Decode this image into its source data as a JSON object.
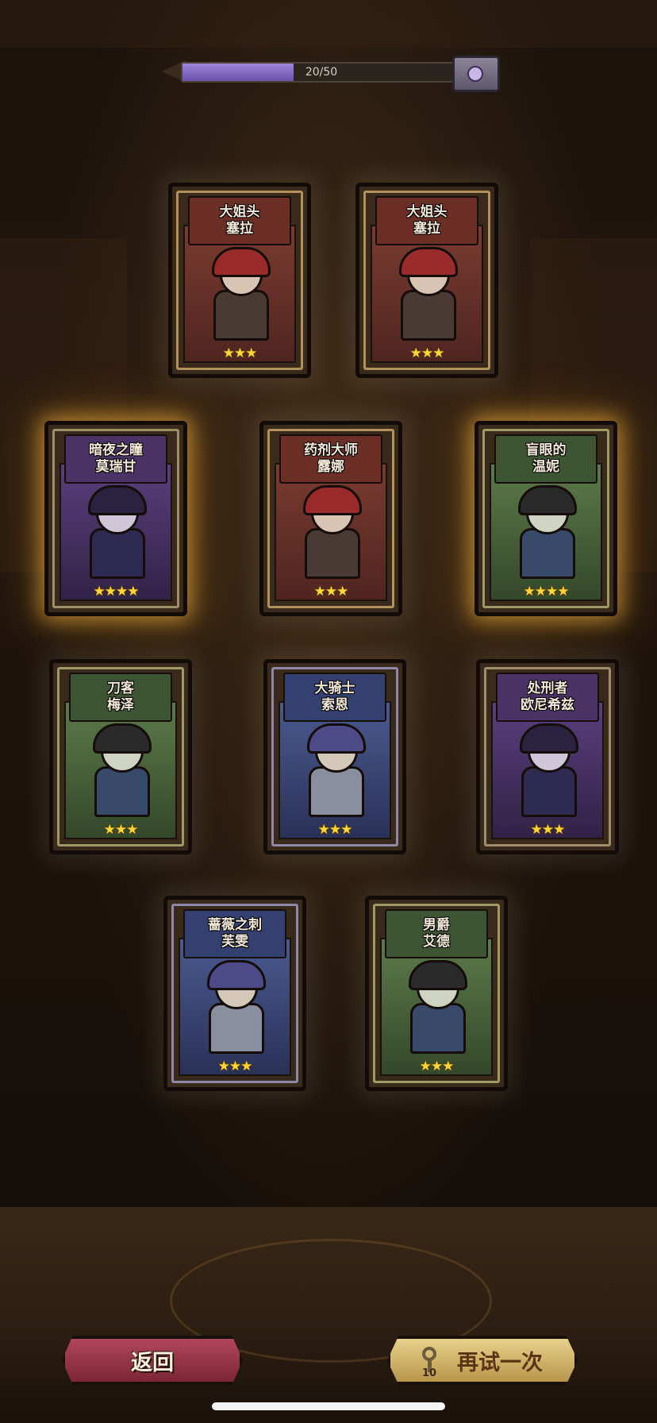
{
  "progress": {
    "text": "20/50",
    "fraction": 0.4
  },
  "cards": [
    {
      "title": "大姐头",
      "name": "塞拉",
      "stars": 3,
      "theme": "red",
      "glow": false
    },
    {
      "title": "大姐头",
      "name": "塞拉",
      "stars": 3,
      "theme": "red",
      "glow": false
    },
    {
      "title": "暗夜之瞳",
      "name": "莫瑞甘",
      "stars": 4,
      "theme": "purple",
      "glow": true
    },
    {
      "title": "药剂大师",
      "name": "露娜",
      "stars": 3,
      "theme": "red",
      "glow": false
    },
    {
      "title": "盲眼的",
      "name": "温妮",
      "stars": 4,
      "theme": "green",
      "glow": true
    },
    {
      "title": "刀客",
      "name": "梅泽",
      "stars": 3,
      "theme": "green",
      "glow": false
    },
    {
      "title": "大骑士",
      "name": "索恩",
      "stars": 3,
      "theme": "blue",
      "glow": false
    },
    {
      "title": "处刑者",
      "name": "欧尼希兹",
      "stars": 3,
      "theme": "purple",
      "glow": false
    },
    {
      "title": "蔷薇之刺",
      "name": "芙雯",
      "stars": 3,
      "theme": "blue",
      "glow": false
    },
    {
      "title": "男爵",
      "name": "艾德",
      "stars": 3,
      "theme": "green",
      "glow": false
    }
  ],
  "buttons": {
    "back_label": "返回",
    "retry_label": "再试一次",
    "retry_cost": "10"
  },
  "icons": {
    "progress_reward": "treasure-chest-icon",
    "retry_cost": "key-icon"
  },
  "colors": {
    "progress_fill": "#8a72c9",
    "star": "#ffd73a",
    "glow": "#ffbe46",
    "back_button": "#9c3547",
    "retry_button": "#d6bc72"
  }
}
